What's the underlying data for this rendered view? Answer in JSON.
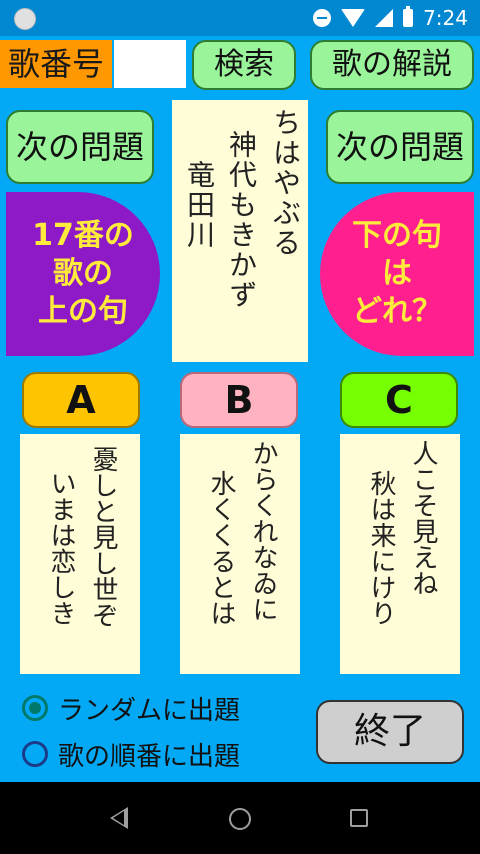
{
  "status_bar": {
    "time": "7:24"
  },
  "header": {
    "poem_number_label": "歌番号",
    "poem_number_value": "",
    "search_label": "検索",
    "explain_label": "歌の解説"
  },
  "quiz": {
    "next_left_label": "次の問題",
    "next_right_label": "次の問題",
    "poem_card_lines": [
      "ちはやぶる",
      "神代もきかず",
      "竜田川"
    ],
    "left_badge_lines": [
      "17番の",
      "歌の",
      "上の句"
    ],
    "right_badge_lines": [
      "下の句",
      "は",
      "どれ？"
    ]
  },
  "options": [
    {
      "label": "A",
      "lines": [
        "憂しと見し世ぞ",
        "いまは恋しき"
      ]
    },
    {
      "label": "B",
      "lines": [
        "からくれなゐに",
        "水くくるとは"
      ]
    },
    {
      "label": "C",
      "lines": [
        "人こそ見えね",
        "秋は来にけり"
      ]
    }
  ],
  "mode": {
    "random_label": "ランダムに出題",
    "sequential_label": "歌の順番に出題",
    "selected": "random"
  },
  "end_label": "終了",
  "colors": {
    "background": "#03a9f4",
    "button_green": "#9af49a",
    "left_badge": "#8e19c7",
    "right_badge": "#ff1f8e",
    "badge_text": "#ffeb3b",
    "option_a": "#ffc400",
    "option_b": "#ffb3c1",
    "option_c": "#76ff03",
    "card": "#fffdd8"
  }
}
